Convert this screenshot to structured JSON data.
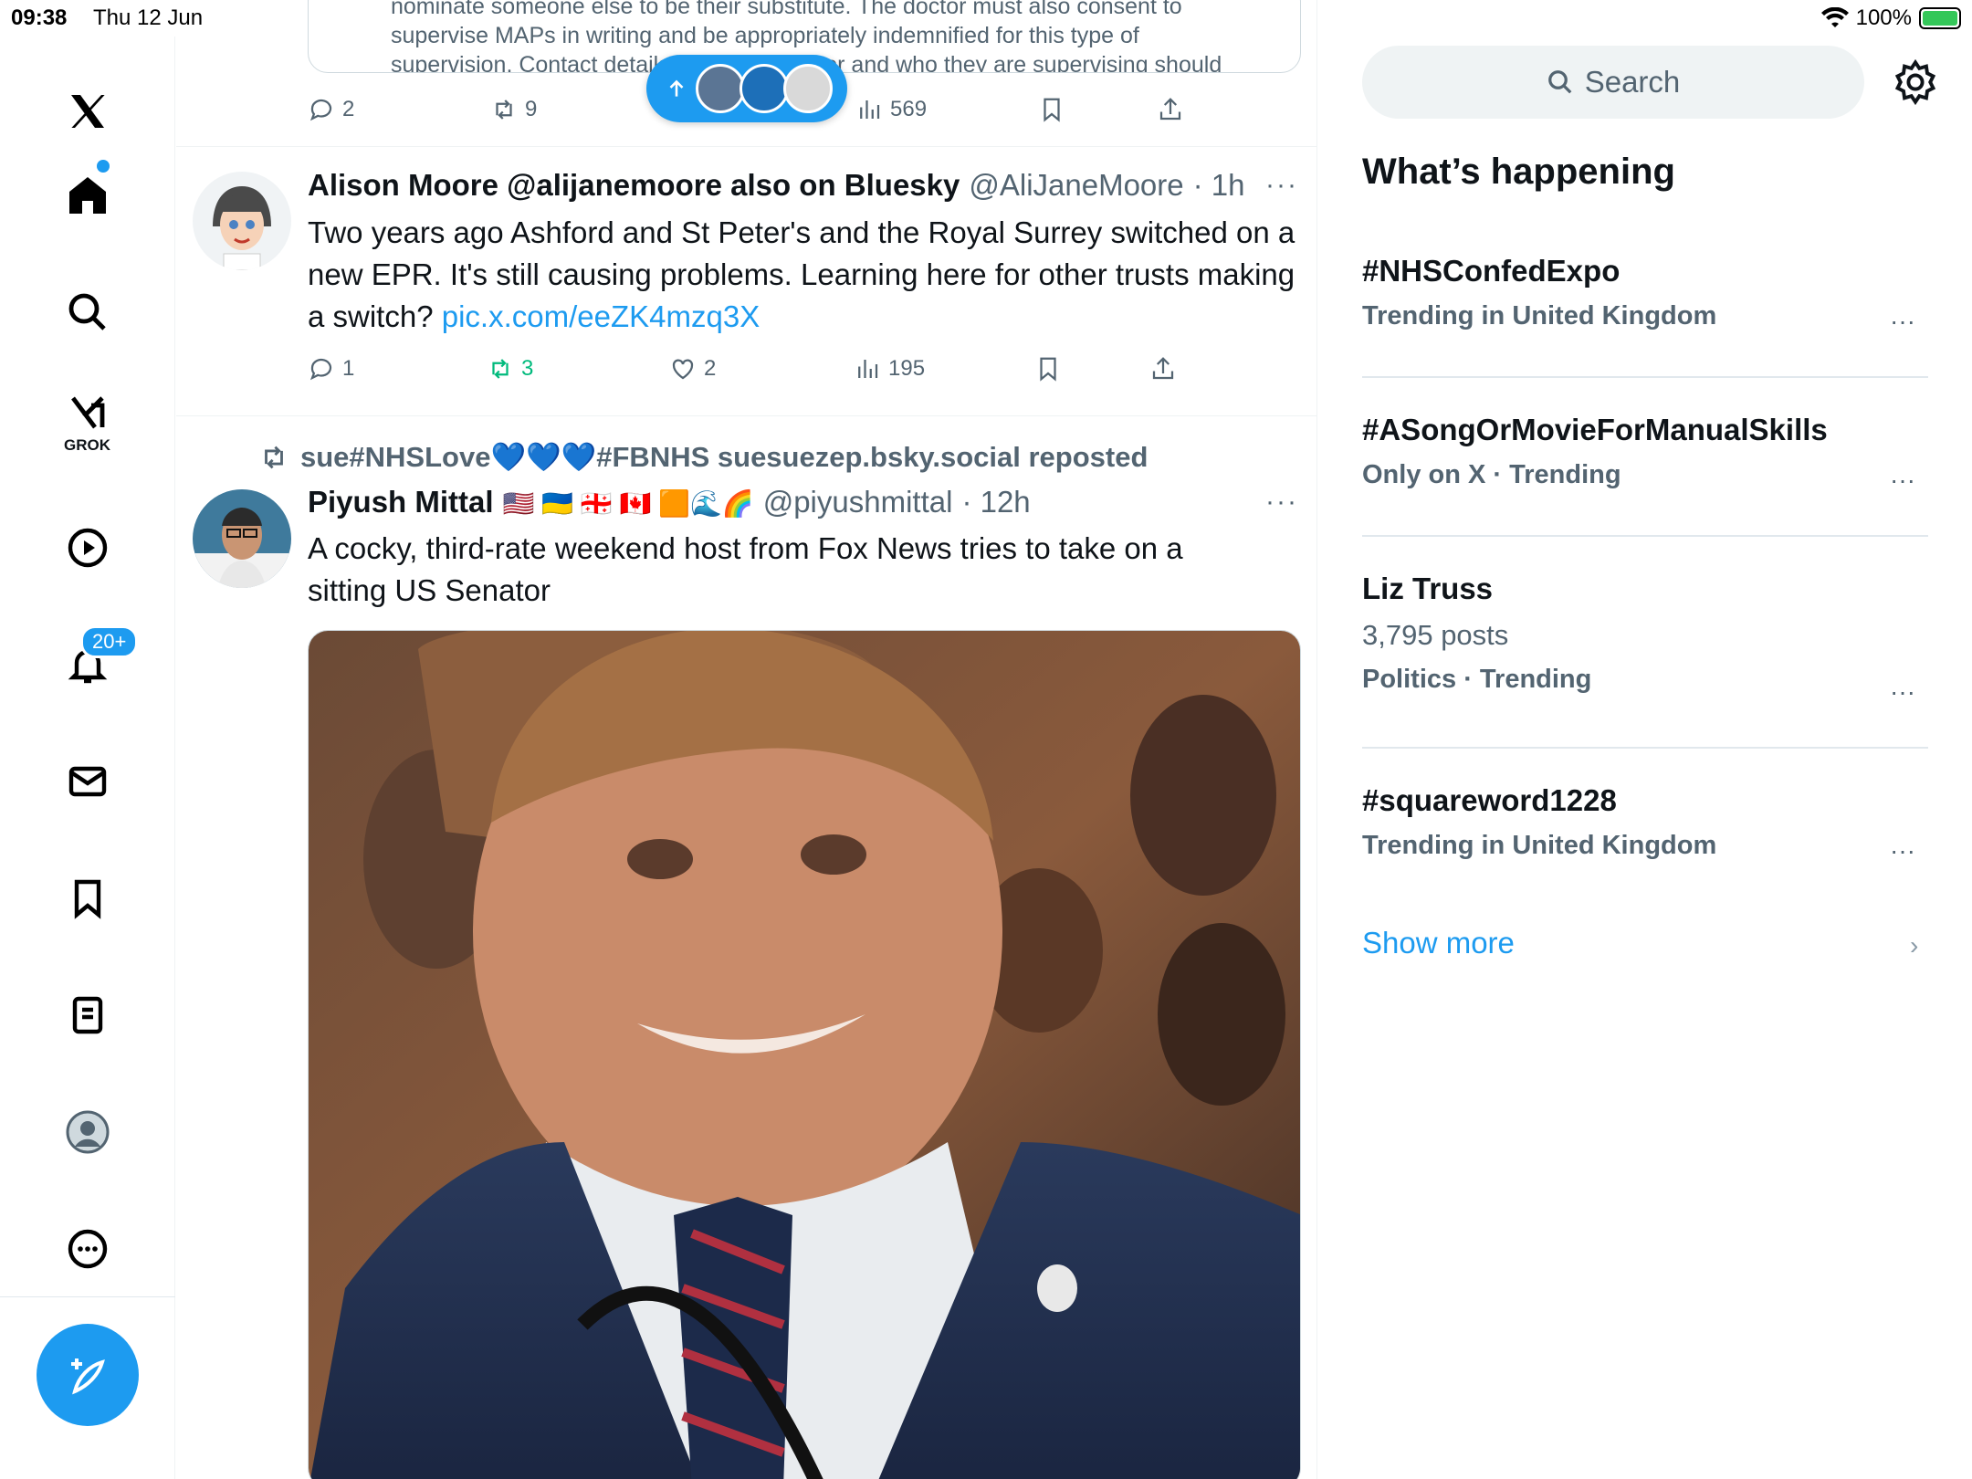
{
  "status": {
    "time": "09:38",
    "date": "Thu 12 Jun",
    "battery": "100%"
  },
  "nav": {
    "grok_label": "GROK",
    "notifications_badge": "20+"
  },
  "quoted_post": {
    "text": "nominate someone else to be their substitute. The doctor must also consent to supervise MAPs in writing and be appropriately indemnified for this type of supervision. Contact details of the supervisor and who they are supervising should be available to the team..."
  },
  "post0_actions": {
    "replies": "2",
    "reposts": "9",
    "views": "569"
  },
  "post1": {
    "name": "Alison Moore @alijanemoore also on Bluesky",
    "handle": "@AliJaneMoore",
    "time": "· 1h",
    "text": "Two years ago Ashford and St Peter's and the Royal Surrey switched on a new EPR. It's still causing problems.  Learning here for other trusts making a switch?",
    "link": "pic.x.com/eeZK4mzq3X",
    "replies": "1",
    "reposts": "3",
    "likes": "2",
    "views": "195"
  },
  "post2": {
    "reposted_by": "sue#NHSLove💙💙💙#FBNHS suesuezep.bsky.social reposted",
    "name": "Piyush Mittal",
    "flags": "🇺🇸 🇺🇦 🇬🇪 🇨🇦 🟧🌊🌈",
    "handle": "@piyushmittal",
    "time": "· 12h",
    "text": "A cocky, third-rate weekend host from Fox News tries to take on a sitting US Senator"
  },
  "right": {
    "search_placeholder": "Search",
    "title": "What’s happening",
    "trends": [
      {
        "name": "#NHSConfedExpo",
        "context": "Trending in United Kingdom",
        "count": ""
      },
      {
        "name": "#ASongOrMovieForManualSkills",
        "context": "Only on X · Trending",
        "count": ""
      },
      {
        "name": "Liz Truss",
        "context": "Politics · Trending",
        "count": "3,795 posts"
      },
      {
        "name": "#squareword1228",
        "context": "Trending in United Kingdom",
        "count": ""
      }
    ],
    "show_more": "Show more"
  },
  "colors": {
    "accent": "#1d9bf0",
    "muted": "#536471",
    "repost_green": "#00ba7c"
  }
}
